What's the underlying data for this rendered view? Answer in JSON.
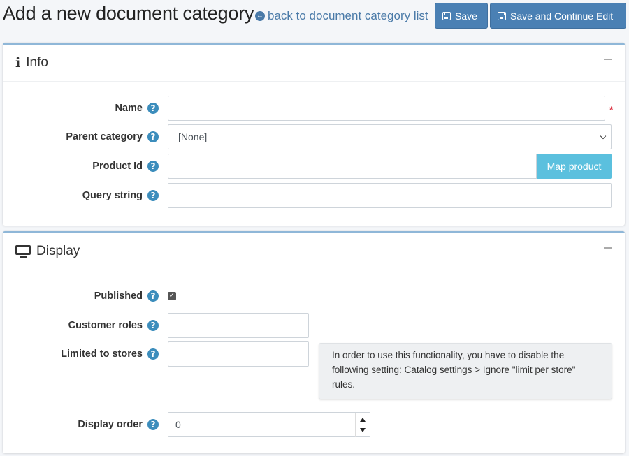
{
  "header": {
    "title": "Add a new document category",
    "back_link": "back to document category list",
    "save_label": "Save",
    "save_continue_label": "Save and Continue Edit"
  },
  "info": {
    "title": "Info",
    "name_label": "Name",
    "name_value": "",
    "parent_label": "Parent category",
    "parent_selected": "[None]",
    "product_label": "Product Id",
    "product_value": "",
    "map_button": "Map product",
    "query_label": "Query string",
    "query_value": ""
  },
  "display": {
    "title": "Display",
    "published_label": "Published",
    "published_checked": true,
    "roles_label": "Customer roles",
    "stores_label": "Limited to stores",
    "store_hint": "In order to use this functionality, you have to disable the following setting: Catalog settings > Ignore \"limit per store\" rules.",
    "order_label": "Display order",
    "order_value": "0"
  },
  "colors": {
    "primary": "#4a80b4",
    "info": "#5bc0de",
    "help": "#3c8dbc",
    "card_border": "#8fb7d8",
    "required": "#dc3545"
  },
  "icons": {
    "back": "arrow-left-circle-icon",
    "save": "floppy-disk-icon",
    "info": "info-icon",
    "display": "monitor-icon",
    "help": "question-circle-icon",
    "collapse": "minus-icon"
  }
}
